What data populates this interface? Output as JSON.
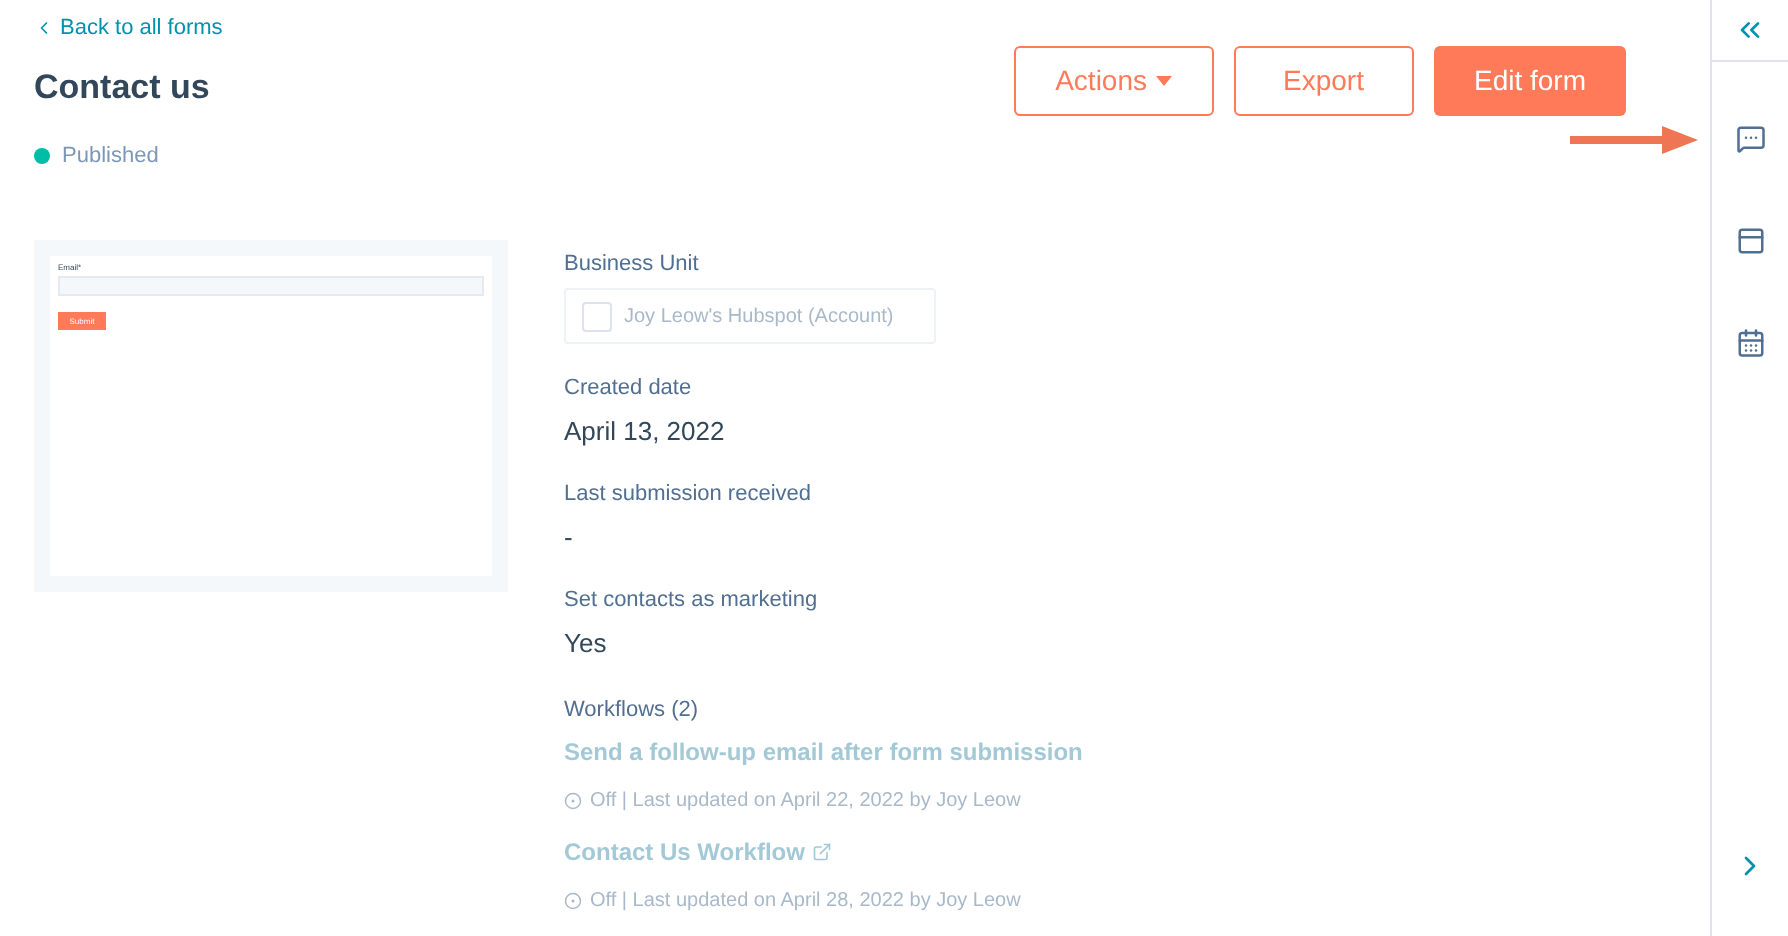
{
  "back_link": "Back to all forms",
  "title": "Contact us",
  "status": {
    "label": "Published",
    "color": "#00bda5"
  },
  "buttons": [
    {
      "label": "Actions",
      "kind": "dropdown"
    },
    {
      "label": "Export",
      "kind": "secondary"
    },
    {
      "label": "Edit form",
      "kind": "primary"
    }
  ],
  "preview": {
    "field_label": "Email*",
    "submit": "Submit"
  },
  "business_unit": {
    "label": "Business Unit",
    "value": "Joy Leow's Hubspot (Account)",
    "disabled": true,
    "checked": false
  },
  "details": [
    {
      "label": "Created date",
      "value": "April 13, 2022"
    },
    {
      "label": "Last submission received",
      "value": "-"
    },
    {
      "label": "Set contacts as marketing",
      "value": "Yes"
    }
  ],
  "workflows": {
    "label": "Workflows (2)",
    "items": [
      {
        "name": "Send a follow-up email after form submission",
        "meta": "Off | Last updated on April 22, 2022 by Joy Leow",
        "external": false
      },
      {
        "name": "Contact Us Workflow",
        "meta": "Off | Last updated on April 28, 2022 by Joy Leow",
        "external": true
      }
    ]
  },
  "sidebar": {
    "items": [
      {
        "kind": "chat"
      },
      {
        "kind": "window"
      },
      {
        "kind": "calendar"
      }
    ]
  }
}
